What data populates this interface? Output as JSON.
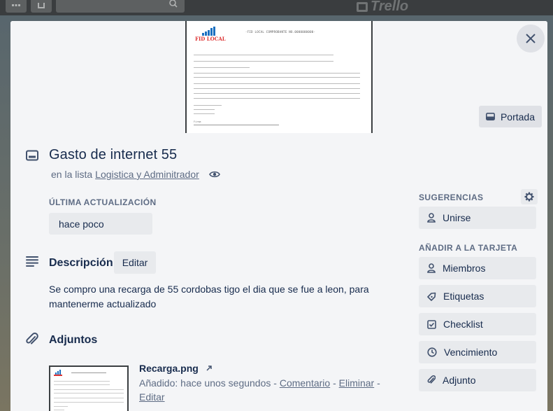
{
  "topbar": {
    "logo_text": "Trello"
  },
  "cover": {
    "button_label": "Portada",
    "receipt": {
      "brand": "FID LOCAL",
      "header": "-FID LOCAL COMPROBANTE NO.0000000000-",
      "footer": "Firma"
    }
  },
  "card": {
    "title": "Gasto de internet 55",
    "in_list_prefix": "en la lista",
    "list_name": "Logistica y Adminitrador"
  },
  "last_update": {
    "label": "Última actualización",
    "value": "hace poco"
  },
  "description": {
    "title": "Descripción",
    "edit_label": "Editar",
    "text": "Se compro una recarga de 55 cordobas tigo el dia que se fue a leon, para mantenerme actualizado"
  },
  "attachments": {
    "title": "Adjuntos",
    "items": [
      {
        "name": "Recarga.png",
        "added": "Añadido: hace unos segundos",
        "sep": " - ",
        "comment": "Comentario",
        "delete": "Eliminar",
        "edit": "Editar"
      }
    ]
  },
  "sidebar": {
    "suggestions_label": "Sugerencias",
    "join_label": "Unirse",
    "add_to_card_label": "Añadir a la tarjeta",
    "members_label": "Miembros",
    "labels_label": "Etiquetas",
    "checklist_label": "Checklist",
    "due_label": "Vencimiento",
    "attachment_label": "Adjunto"
  },
  "colors": {
    "modal_bg": "#f4f5f7",
    "button_bg": "#e8eaed",
    "text": "#172b4d",
    "muted": "#5e6c84"
  }
}
